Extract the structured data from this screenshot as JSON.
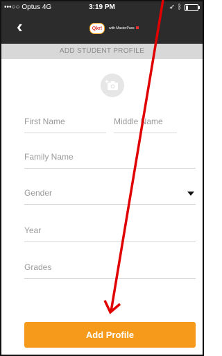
{
  "status_bar": {
    "carrier": "•••○○ Optus 4G",
    "time": "3:19 PM",
    "battery_level": 0.2
  },
  "header": {
    "back_icon": "chevron-left-icon",
    "logo_badge": "Qkr!",
    "logo_text": "with MasterPass"
  },
  "section_title": "ADD STUDENT PROFILE",
  "photo": {
    "icon": "camera-add-icon"
  },
  "form": {
    "first_name_placeholder": "First Name",
    "middle_name_placeholder": "Middle Name",
    "family_name_placeholder": "Family Name",
    "gender_label": "Gender",
    "year_placeholder": "Year",
    "grades_placeholder": "Grades"
  },
  "actions": {
    "add_profile_label": "Add Profile"
  },
  "colors": {
    "appbar": "#2c2c2c",
    "section_bar": "#d8d8d8",
    "button": "#f59a1b",
    "annotation_arrow": "#e00000"
  }
}
